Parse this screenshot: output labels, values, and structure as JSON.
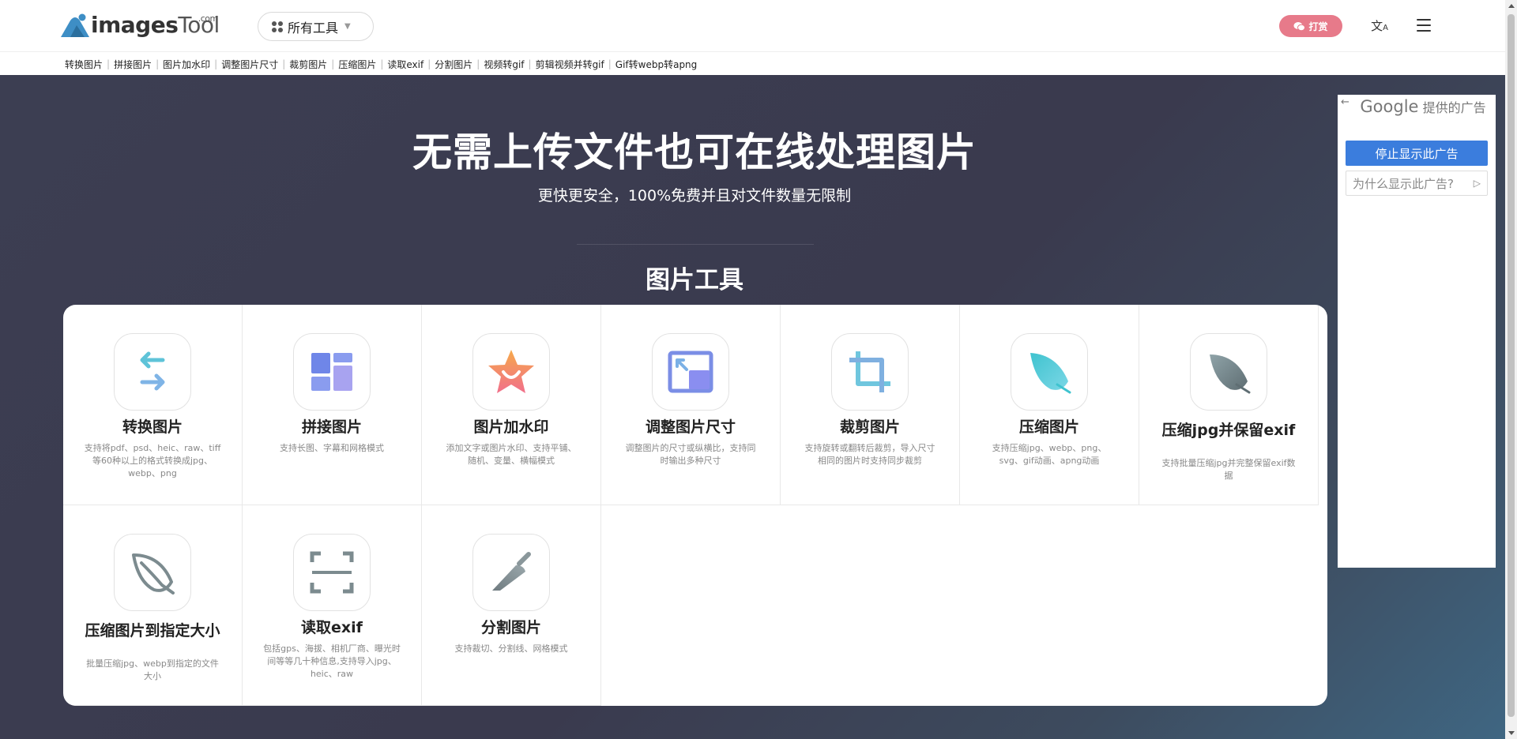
{
  "header": {
    "logo_main": "images",
    "logo_tool": "Tool",
    "logo_com": ".com",
    "all_tools_label": "所有工具",
    "donate_label": "打赏",
    "translate_icon": "translate-icon",
    "menu_icon": "hamburger-menu-icon"
  },
  "quicknav": [
    "转换图片",
    "拼接图片",
    "图片加水印",
    "调整图片尺寸",
    "裁剪图片",
    "压缩图片",
    "读取exif",
    "分割图片",
    "视频转gif",
    "剪辑视频并转gif",
    "Gif转webp转apng"
  ],
  "hero": {
    "title": "无需上传文件也可在线处理图片",
    "subtitle": "更快更安全，100%免费并且对文件数量无限制",
    "section_title": "图片工具"
  },
  "tools": [
    {
      "name": "转换图片",
      "desc": "支持将pdf、psd、heic、raw、tiff等60种以上的格式转换成jpg、webp、png",
      "icon": "convert-arrows-icon"
    },
    {
      "name": "拼接图片",
      "desc": "支持长图、字幕和网格模式",
      "icon": "collage-layout-icon"
    },
    {
      "name": "图片加水印",
      "desc": "添加文字或图片水印、支持平铺、随机、变量、横幅模式",
      "icon": "star-watermark-icon"
    },
    {
      "name": "调整图片尺寸",
      "desc": "调整图片的尺寸或纵横比，支持同时输出多种尺寸",
      "icon": "resize-image-icon"
    },
    {
      "name": "裁剪图片",
      "desc": "支持旋转或翻转后裁剪，导入尺寸相同的图片时支持同步裁剪",
      "icon": "crop-icon"
    },
    {
      "name": "压缩图片",
      "desc": "支持压缩jpg、webp、png、svg、gif动画、apng动画",
      "icon": "feather-compress-icon"
    },
    {
      "name": "压缩jpg并保留exif",
      "desc": "支持批量压缩jpg并完整保留exif数据",
      "icon": "feather-gray-icon"
    },
    {
      "name": "压缩图片到指定大小",
      "desc": "批量压缩jpg、webp到指定的文件大小",
      "icon": "feather-outline-icon"
    },
    {
      "name": "读取exif",
      "desc": "包括gps、海拔、相机厂商、曝光时间等等几十种信息,支持导入jpg、heic、raw",
      "icon": "scan-frame-icon"
    },
    {
      "name": "分割图片",
      "desc": "支持裁切、分割线、网格模式",
      "icon": "knife-split-icon"
    }
  ],
  "ad": {
    "back_icon": "back-arrow-icon",
    "google": "Google",
    "provided": "提供的广告",
    "stop_label": "停止显示此广告",
    "why_label": "为什么显示此广告?",
    "why_icon": "ad-choices-icon"
  },
  "colors": {
    "donate": "#e77a8a",
    "ad_button": "#3b7ddd",
    "hero_bg": "#3c3e52"
  }
}
